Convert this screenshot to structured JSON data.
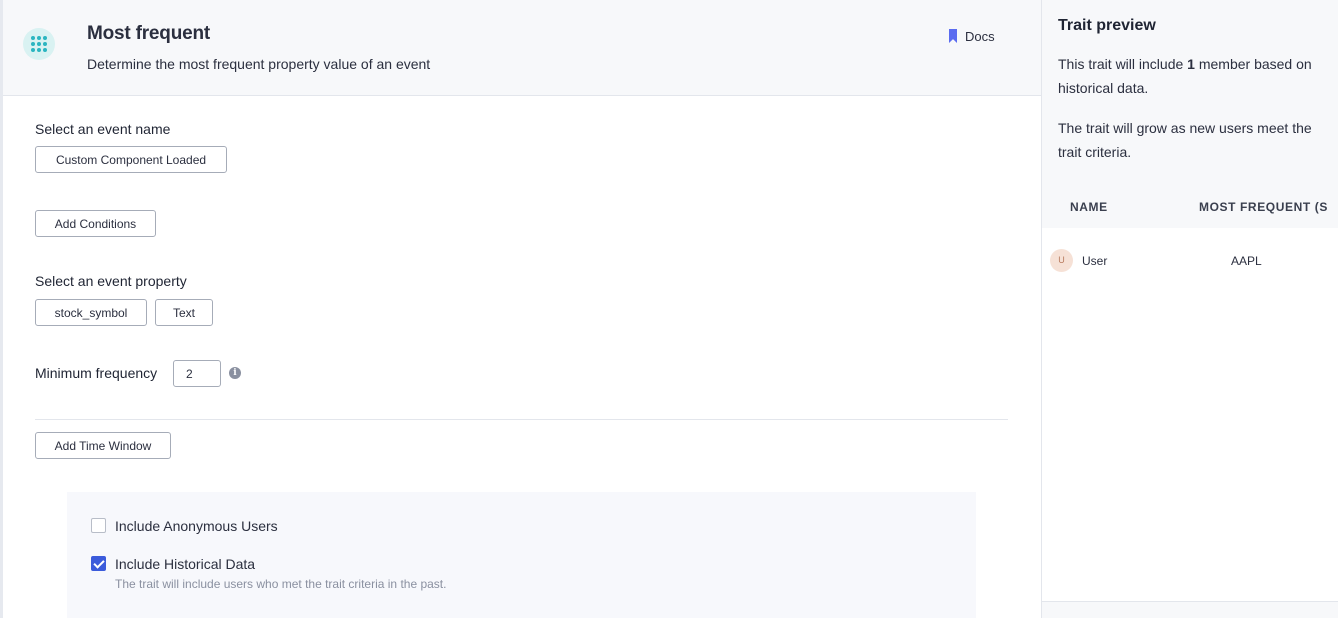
{
  "header": {
    "icon": "dots-grid-icon",
    "title": "Most frequent",
    "subtitle": "Determine the most frequent property value of an event",
    "docs_label": "Docs",
    "docs_icon": "bookmark-icon",
    "accent_color": "#5b6cf0"
  },
  "form": {
    "event_name_label": "Select an event name",
    "event_name_value": "Custom Component Loaded",
    "add_conditions_label": "Add Conditions",
    "event_property_label": "Select an event property",
    "event_property_value": "stock_symbol",
    "property_type_value": "Text",
    "min_frequency_label": "Minimum frequency",
    "min_frequency_value": "2",
    "info_icon": "info-icon",
    "add_time_window_label": "Add Time Window"
  },
  "options": {
    "anonymous": {
      "label": "Include Anonymous Users",
      "checked": false
    },
    "historical": {
      "label": "Include Historical Data",
      "checked": true,
      "help": "The trait will include users who met the trait criteria in the past."
    }
  },
  "preview": {
    "title": "Trait preview",
    "summary_pre": "This trait will include ",
    "summary_count": "1",
    "summary_post": " member based on historical data.",
    "growth_text": "The trait will grow as new users meet the trait criteria.",
    "columns": [
      "NAME",
      "MOST FREQUENT (S"
    ],
    "rows": [
      {
        "avatar_initial": "U",
        "name": "User",
        "value": "AAPL"
      }
    ]
  }
}
